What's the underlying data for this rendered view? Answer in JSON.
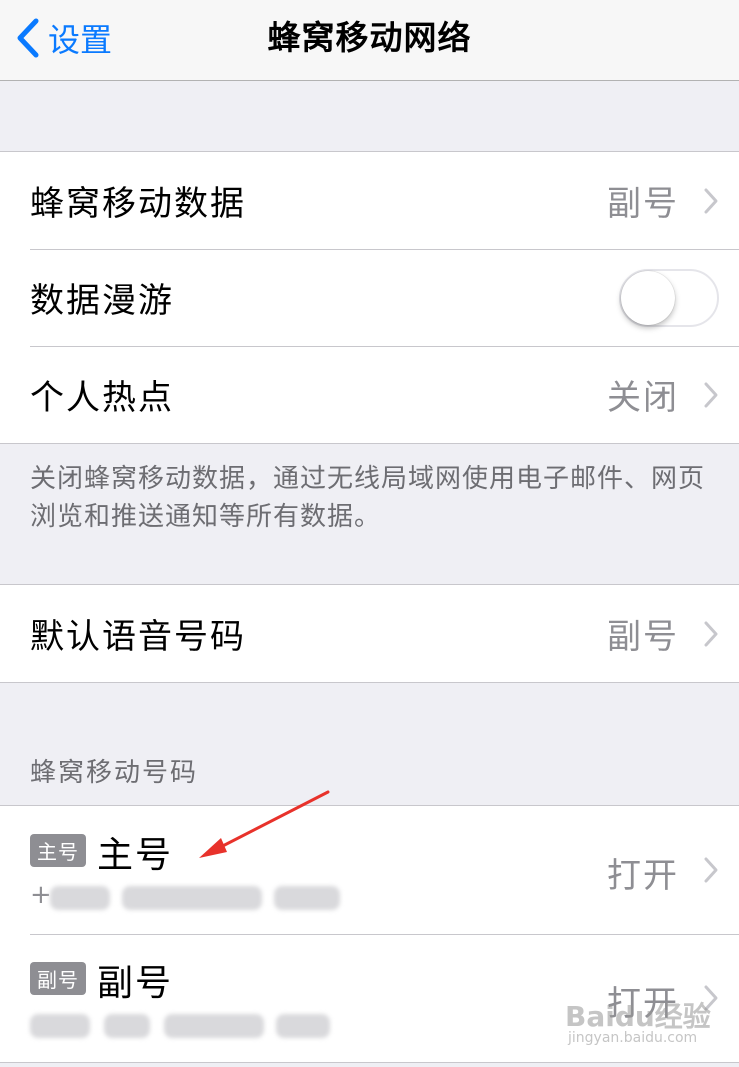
{
  "navbar": {
    "back_label": "设置",
    "title": "蜂窝移动网络"
  },
  "group1": {
    "rows": [
      {
        "label": "蜂窝移动数据",
        "value": "副号"
      },
      {
        "label": "数据漫游",
        "toggle_on": false
      },
      {
        "label": "个人热点",
        "value": "关闭"
      }
    ]
  },
  "footer_note": "关闭蜂窝移动数据，通过无线局域网使用电子邮件、网页浏览和推送通知等所有数据。",
  "group2": {
    "rows": [
      {
        "label": "默认语音号码",
        "value": "副号"
      }
    ]
  },
  "section_header": "蜂窝移动号码",
  "sims": [
    {
      "badge": "主号",
      "name": "主号",
      "number_prefix": "+",
      "value": "打开"
    },
    {
      "badge": "副号",
      "name": "副号",
      "number_prefix": "",
      "value": "打开"
    }
  ],
  "watermark": {
    "main": "Baidu经验",
    "sub": "jingyan.baidu.com"
  },
  "colors": {
    "accent": "#0a7aff",
    "annotation_arrow": "#e8322b"
  },
  "icons": {
    "back": "chevron-left-icon",
    "disclosure": "chevron-right-icon"
  }
}
